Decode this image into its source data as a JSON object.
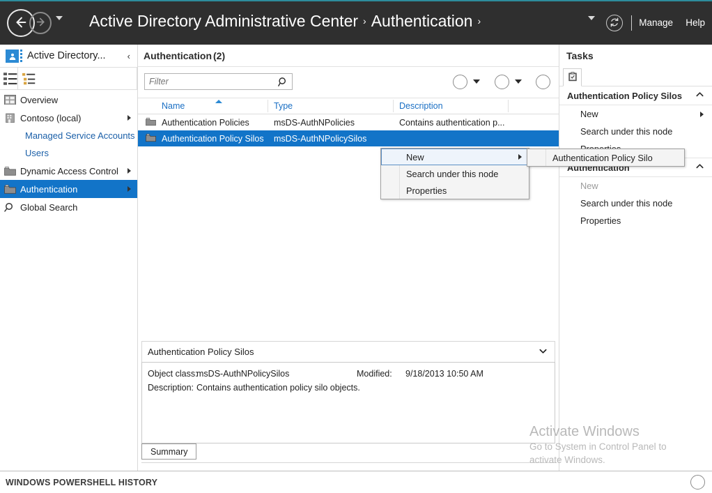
{
  "topbar": {
    "app_title": "Active Directory Administrative Center",
    "breadcrumb_sep": "›",
    "breadcrumb_node": "Authentication",
    "breadcrumb_node_sep": "›",
    "manage_label": "Manage",
    "help_label": "Help",
    "back_icon": "back-arrow-icon",
    "forward_icon": "forward-arrow-icon",
    "refresh_icon": "refresh-icon",
    "bg_color": "#2f2f2f",
    "accent_color": "#2d8c9c"
  },
  "sidebar": {
    "title": "Active Directory...",
    "collapse_label": "‹",
    "view_list_icon": "list-view-icon",
    "view_tree_icon": "tree-view-icon",
    "items": [
      {
        "label": "Overview",
        "icon": "overview-icon",
        "has_arrow": false,
        "selected": false
      },
      {
        "label": "Contoso (local)",
        "icon": "domain-icon",
        "has_arrow": true,
        "selected": false
      },
      {
        "label": "Dynamic Access Control",
        "icon": "folder-icon",
        "has_arrow": true,
        "selected": false
      },
      {
        "label": "Authentication",
        "icon": "folder-icon",
        "has_arrow": true,
        "selected": true
      },
      {
        "label": "Global Search",
        "icon": "search-icon",
        "has_arrow": false,
        "selected": false
      }
    ],
    "children": [
      {
        "label": "Managed Service Accounts"
      },
      {
        "label": "Users"
      }
    ],
    "selected_color": "#1274c8",
    "link_color": "#1a5fa8"
  },
  "content": {
    "header_title": "Authentication",
    "header_count": "(2)",
    "filter_placeholder": "Filter",
    "filter_value": "",
    "search_icon": "search-icon",
    "view_button_icon": "list-options-icon",
    "save_button_icon": "save-disk-icon",
    "expand_button_icon": "chevron-down-circle-icon",
    "columns": [
      "Name",
      "Type",
      "Description"
    ],
    "sort_column": "Name",
    "sort_direction": "ascending",
    "rows": [
      {
        "name": "Authentication Policies",
        "type": "msDS-AuthNPolicies",
        "description": "Contains authentication p...",
        "icon": "folder-icon",
        "selected": false
      },
      {
        "name": "Authentication Policy Silos",
        "type": "msDS-AuthNPolicySilos",
        "description": "",
        "icon": "folder-icon",
        "selected": true
      }
    ]
  },
  "details": {
    "header_title": "Authentication Policy Silos",
    "header_chevron": "⌵",
    "fields": [
      {
        "label": "Object class:",
        "value": "msDS-AuthNPolicySilos"
      },
      {
        "label": "Description:",
        "value": "Contains authentication policy silo objects."
      },
      {
        "label": "Modified:",
        "value": "9/18/2013 10:50 AM"
      }
    ],
    "tab_label": "Summary"
  },
  "tasks": {
    "header_title": "Tasks",
    "tab_icon": "clipboard-icon",
    "sections": [
      {
        "title": "Authentication Policy Silos",
        "chevron": "⌃",
        "items": [
          {
            "label": "New",
            "has_arrow": true,
            "dim": false
          },
          {
            "label": "Search under this node",
            "has_arrow": false,
            "dim": false
          },
          {
            "label": "Properties",
            "has_arrow": false,
            "dim": false
          }
        ]
      },
      {
        "title": "Authentication",
        "chevron": "⌃",
        "items": [
          {
            "label": "New",
            "has_arrow": false,
            "dim": true
          },
          {
            "label": "Search under this node",
            "has_arrow": false,
            "dim": false
          },
          {
            "label": "Properties",
            "has_arrow": false,
            "dim": false
          }
        ]
      }
    ]
  },
  "context_menu": {
    "items": [
      {
        "label": "New",
        "has_arrow": true,
        "highlighted": true
      },
      {
        "label": "Search under this node",
        "has_arrow": false,
        "highlighted": false
      },
      {
        "label": "Properties",
        "has_arrow": false,
        "highlighted": false
      }
    ]
  },
  "context_submenu": {
    "items": [
      {
        "label": "Authentication Policy Silo",
        "has_arrow": false,
        "highlighted": false
      }
    ]
  },
  "watermark": {
    "line1": "Activate Windows",
    "line2": "Go to System in Control Panel to",
    "line3": "activate Windows."
  },
  "bottombar": {
    "title": "WINDOWS POWERSHELL HISTORY",
    "expand_icon": "chevron-up-circle-icon"
  }
}
